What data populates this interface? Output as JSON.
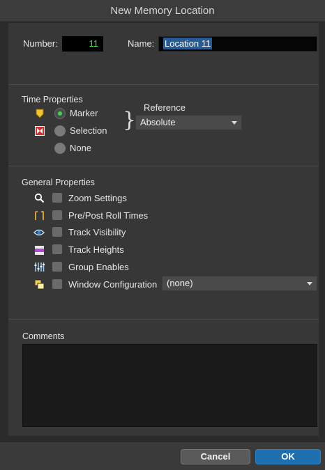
{
  "window": {
    "title": "New Memory Location"
  },
  "identity": {
    "number_label": "Number:",
    "number_value": "11",
    "name_label": "Name:",
    "name_value": "Location 11"
  },
  "time_properties": {
    "title": "Time Properties",
    "options": [
      {
        "label": "Marker",
        "selected": true,
        "icon": "marker-icon"
      },
      {
        "label": "Selection",
        "selected": false,
        "icon": "selection-icon"
      },
      {
        "label": "None",
        "selected": false,
        "icon": ""
      }
    ],
    "reference_label": "Reference",
    "reference_value": "Absolute"
  },
  "general_properties": {
    "title": "General Properties",
    "items": [
      {
        "label": "Zoom Settings",
        "icon": "magnifier-icon",
        "checked": false
      },
      {
        "label": "Pre/Post Roll Times",
        "icon": "preroll-icon",
        "checked": false
      },
      {
        "label": "Track Visibility",
        "icon": "eye-icon",
        "checked": false
      },
      {
        "label": "Track Heights",
        "icon": "track-heights-icon",
        "checked": false
      },
      {
        "label": "Group Enables",
        "icon": "group-enables-icon",
        "checked": false
      },
      {
        "label": "Window Configuration",
        "icon": "window-config-icon",
        "checked": false
      }
    ],
    "window_config_value": "(none)"
  },
  "comments": {
    "title": "Comments",
    "value": ""
  },
  "buttons": {
    "cancel": "Cancel",
    "ok": "OK"
  },
  "colors": {
    "accent_blue": "#1f6fb0",
    "radio_green": "#3bd64a",
    "number_green": "#4ee04e",
    "marker_yellow": "#f2c230",
    "selection_red": "#c8332f"
  }
}
